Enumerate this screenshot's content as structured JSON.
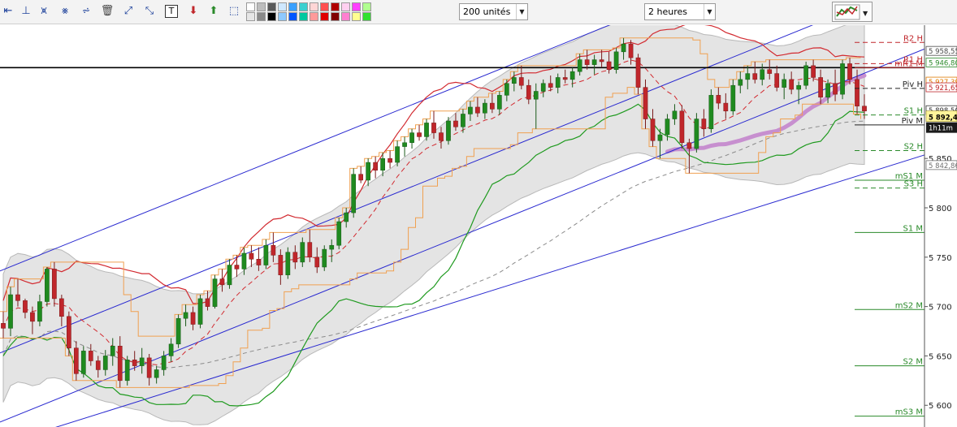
{
  "toolbar": {
    "tools": [
      "arrow-line-icon",
      "vertical-line-icon",
      "channel-icon",
      "fan-icon",
      "regression-icon",
      "trash-icon",
      "trendline-icon",
      "trendline-ext-icon",
      "text-tool-icon",
      "arrow-down-icon",
      "arrow-up-icon",
      "rectangle-icon"
    ],
    "text_tool_label": "T",
    "swatch_colors": [
      "#ffffff",
      "#e6e6e6",
      "#bdbdbd",
      "#8a8a8a",
      "#595959",
      "#000000",
      "#cfe8ff",
      "#8ec9ff",
      "#3aa0ff",
      "#0055ff",
      "#3ad0d0",
      "#00c8a0",
      "#ffd6d6",
      "#ff9a9a",
      "#ff5050",
      "#e00000",
      "#b00000",
      "#800000",
      "#ffd0f0",
      "#ff80d0",
      "#ff40ff",
      "#ffff90",
      "#b0ff90",
      "#30e030"
    ],
    "units_select": "200 unités",
    "period_select": "2 heures"
  },
  "chart_data": {
    "type": "candlestick",
    "ylim": [
      5578,
      5985
    ],
    "y_ticks": [
      5850,
      5800,
      5750,
      5700,
      5650,
      5600
    ],
    "last_price": "5 892,4",
    "countdown": "1h11m",
    "price_tags": [
      {
        "label": "5 958,55",
        "value": 5958.55,
        "color": "#4a4a4a"
      },
      {
        "label": "5 946,80",
        "value": 5946.8,
        "color": "#2a8a2a"
      },
      {
        "label": "5 927,39",
        "value": 5927.39,
        "color": "#e07b00"
      },
      {
        "label": "5 921,65",
        "value": 5921.65,
        "color": "#c0262b"
      },
      {
        "label": "5 898,50",
        "value": 5898.5,
        "color": "#333333"
      },
      {
        "label": "5 842,86",
        "value": 5842.86,
        "color": "#6f6f6f"
      }
    ],
    "levels": [
      {
        "label": "R2 H",
        "value": 5967.5,
        "color": "#c0262b",
        "dash": true
      },
      {
        "label": "R1 H",
        "value": 5946,
        "color": "#c0262b",
        "dash": true
      },
      {
        "label": "mR1 M",
        "value": 5942,
        "color": "#c0262b",
        "dash": false
      },
      {
        "label": "Piv H",
        "value": 5921,
        "color": "#222222",
        "dash": true
      },
      {
        "label": "S1 H",
        "value": 5894,
        "color": "#2a8a2a",
        "dash": true
      },
      {
        "label": "Piv M",
        "value": 5884,
        "color": "#222222",
        "dash": false
      },
      {
        "label": "S2 H",
        "value": 5858,
        "color": "#2a8a2a",
        "dash": true
      },
      {
        "label": "mS1 M",
        "value": 5828,
        "color": "#2a8a2a",
        "dash": false
      },
      {
        "label": "S3 H",
        "value": 5820,
        "color": "#2a8a2a",
        "dash": true
      },
      {
        "label": "S1 M",
        "value": 5775,
        "color": "#2a8a2a",
        "dash": false
      },
      {
        "label": "mS2 M",
        "value": 5697,
        "color": "#2a8a2a",
        "dash": false
      },
      {
        "label": "S2 M",
        "value": 5640,
        "color": "#2a8a2a",
        "dash": false
      },
      {
        "label": "mS3 M",
        "value": 5589,
        "color": "#2a8a2a",
        "dash": false
      }
    ],
    "horizontal_line": 5942,
    "candles": [
      [
        5683,
        5695,
        5668,
        5678
      ],
      [
        5678,
        5720,
        5670,
        5712
      ],
      [
        5712,
        5728,
        5700,
        5706
      ],
      [
        5706,
        5708,
        5688,
        5694
      ],
      [
        5694,
        5700,
        5672,
        5685
      ],
      [
        5685,
        5712,
        5680,
        5705
      ],
      [
        5705,
        5740,
        5700,
        5738
      ],
      [
        5738,
        5745,
        5700,
        5708
      ],
      [
        5708,
        5712,
        5680,
        5690
      ],
      [
        5690,
        5695,
        5650,
        5658
      ],
      [
        5658,
        5665,
        5625,
        5632
      ],
      [
        5632,
        5660,
        5628,
        5655
      ],
      [
        5655,
        5662,
        5640,
        5645
      ],
      [
        5645,
        5650,
        5628,
        5636
      ],
      [
        5636,
        5656,
        5630,
        5650
      ],
      [
        5650,
        5668,
        5640,
        5660
      ],
      [
        5660,
        5670,
        5618,
        5625
      ],
      [
        5625,
        5650,
        5620,
        5646
      ],
      [
        5646,
        5655,
        5635,
        5640
      ],
      [
        5640,
        5658,
        5632,
        5648
      ],
      [
        5648,
        5652,
        5620,
        5628
      ],
      [
        5628,
        5640,
        5622,
        5636
      ],
      [
        5636,
        5655,
        5630,
        5650
      ],
      [
        5650,
        5668,
        5644,
        5662
      ],
      [
        5662,
        5692,
        5658,
        5688
      ],
      [
        5688,
        5702,
        5680,
        5694
      ],
      [
        5694,
        5700,
        5676,
        5682
      ],
      [
        5682,
        5712,
        5678,
        5708
      ],
      [
        5708,
        5716,
        5696,
        5700
      ],
      [
        5700,
        5732,
        5698,
        5728
      ],
      [
        5728,
        5738,
        5715,
        5722
      ],
      [
        5722,
        5748,
        5718,
        5742
      ],
      [
        5742,
        5752,
        5730,
        5738
      ],
      [
        5738,
        5760,
        5732,
        5754
      ],
      [
        5754,
        5762,
        5740,
        5748
      ],
      [
        5748,
        5760,
        5736,
        5742
      ],
      [
        5742,
        5768,
        5738,
        5762
      ],
      [
        5762,
        5775,
        5745,
        5752
      ],
      [
        5752,
        5758,
        5722,
        5732
      ],
      [
        5732,
        5760,
        5728,
        5755
      ],
      [
        5755,
        5762,
        5738,
        5745
      ],
      [
        5745,
        5770,
        5740,
        5765
      ],
      [
        5765,
        5778,
        5745,
        5750
      ],
      [
        5750,
        5760,
        5734,
        5740
      ],
      [
        5740,
        5762,
        5736,
        5758
      ],
      [
        5758,
        5768,
        5745,
        5762
      ],
      [
        5762,
        5790,
        5758,
        5786
      ],
      [
        5786,
        5800,
        5780,
        5795
      ],
      [
        5795,
        5840,
        5790,
        5834
      ],
      [
        5834,
        5842,
        5825,
        5828
      ],
      [
        5828,
        5850,
        5822,
        5846
      ],
      [
        5846,
        5852,
        5830,
        5838
      ],
      [
        5838,
        5856,
        5832,
        5850
      ],
      [
        5850,
        5858,
        5840,
        5846
      ],
      [
        5846,
        5868,
        5842,
        5862
      ],
      [
        5862,
        5872,
        5852,
        5866
      ],
      [
        5866,
        5880,
        5860,
        5876
      ],
      [
        5876,
        5884,
        5868,
        5872
      ],
      [
        5872,
        5890,
        5868,
        5886
      ],
      [
        5886,
        5898,
        5870,
        5876
      ],
      [
        5876,
        5882,
        5860,
        5868
      ],
      [
        5868,
        5892,
        5864,
        5888
      ],
      [
        5888,
        5896,
        5878,
        5882
      ],
      [
        5882,
        5900,
        5876,
        5895
      ],
      [
        5895,
        5908,
        5888,
        5902
      ],
      [
        5902,
        5912,
        5892,
        5896
      ],
      [
        5896,
        5910,
        5890,
        5906
      ],
      [
        5906,
        5916,
        5896,
        5900
      ],
      [
        5900,
        5918,
        5894,
        5914
      ],
      [
        5914,
        5930,
        5908,
        5926
      ],
      [
        5926,
        5938,
        5918,
        5932
      ],
      [
        5932,
        5944,
        5920,
        5924
      ],
      [
        5924,
        5930,
        5905,
        5910
      ],
      [
        5910,
        5926,
        5880,
        5918
      ],
      [
        5918,
        5930,
        5912,
        5926
      ],
      [
        5926,
        5934,
        5918,
        5922
      ],
      [
        5922,
        5936,
        5916,
        5932
      ],
      [
        5932,
        5940,
        5926,
        5930
      ],
      [
        5930,
        5942,
        5922,
        5938
      ],
      [
        5938,
        5956,
        5934,
        5950
      ],
      [
        5950,
        5960,
        5940,
        5945
      ],
      [
        5945,
        5955,
        5935,
        5950
      ],
      [
        5950,
        5960,
        5942,
        5948
      ],
      [
        5948,
        5958,
        5936,
        5940
      ],
      [
        5940,
        5962,
        5936,
        5958
      ],
      [
        5958,
        5972,
        5950,
        5966
      ],
      [
        5966,
        5970,
        5945,
        5952
      ],
      [
        5952,
        5956,
        5915,
        5922
      ],
      [
        5922,
        5930,
        5880,
        5890
      ],
      [
        5890,
        5900,
        5862,
        5868
      ],
      [
        5868,
        5880,
        5850,
        5874
      ],
      [
        5874,
        5895,
        5868,
        5890
      ],
      [
        5890,
        5905,
        5884,
        5898
      ],
      [
        5898,
        5904,
        5860,
        5866
      ],
      [
        5866,
        5870,
        5835,
        5860
      ],
      [
        5860,
        5896,
        5856,
        5890
      ],
      [
        5890,
        5900,
        5872,
        5880
      ],
      [
        5880,
        5920,
        5876,
        5914
      ],
      [
        5914,
        5922,
        5900,
        5906
      ],
      [
        5906,
        5916,
        5890,
        5898
      ],
      [
        5898,
        5930,
        5894,
        5924
      ],
      [
        5924,
        5938,
        5916,
        5930
      ],
      [
        5930,
        5944,
        5920,
        5936
      ],
      [
        5936,
        5948,
        5926,
        5930
      ],
      [
        5930,
        5946,
        5924,
        5940
      ],
      [
        5940,
        5950,
        5930,
        5936
      ],
      [
        5936,
        5944,
        5918,
        5922
      ],
      [
        5922,
        5936,
        5910,
        5930
      ],
      [
        5930,
        5938,
        5915,
        5920
      ],
      [
        5920,
        5928,
        5905,
        5924
      ],
      [
        5924,
        5948,
        5920,
        5944
      ],
      [
        5944,
        5950,
        5928,
        5932
      ],
      [
        5932,
        5940,
        5905,
        5912
      ],
      [
        5912,
        5930,
        5906,
        5926
      ],
      [
        5926,
        5940,
        5908,
        5915
      ],
      [
        5915,
        5950,
        5910,
        5946
      ],
      [
        5946,
        5952,
        5925,
        5930
      ],
      [
        5930,
        5940,
        5895,
        5903
      ],
      [
        5903,
        5915,
        5890,
        5898
      ]
    ],
    "channel_lines": [
      [
        [
          0,
          5736
        ],
        [
          1066,
          6090
        ]
      ],
      [
        [
          0,
          5653
        ],
        [
          1066,
          6007
        ]
      ],
      [
        [
          0,
          5583
        ],
        [
          1066,
          5937
        ]
      ],
      [
        [
          0,
          5560
        ],
        [
          1066,
          5835
        ]
      ]
    ]
  }
}
